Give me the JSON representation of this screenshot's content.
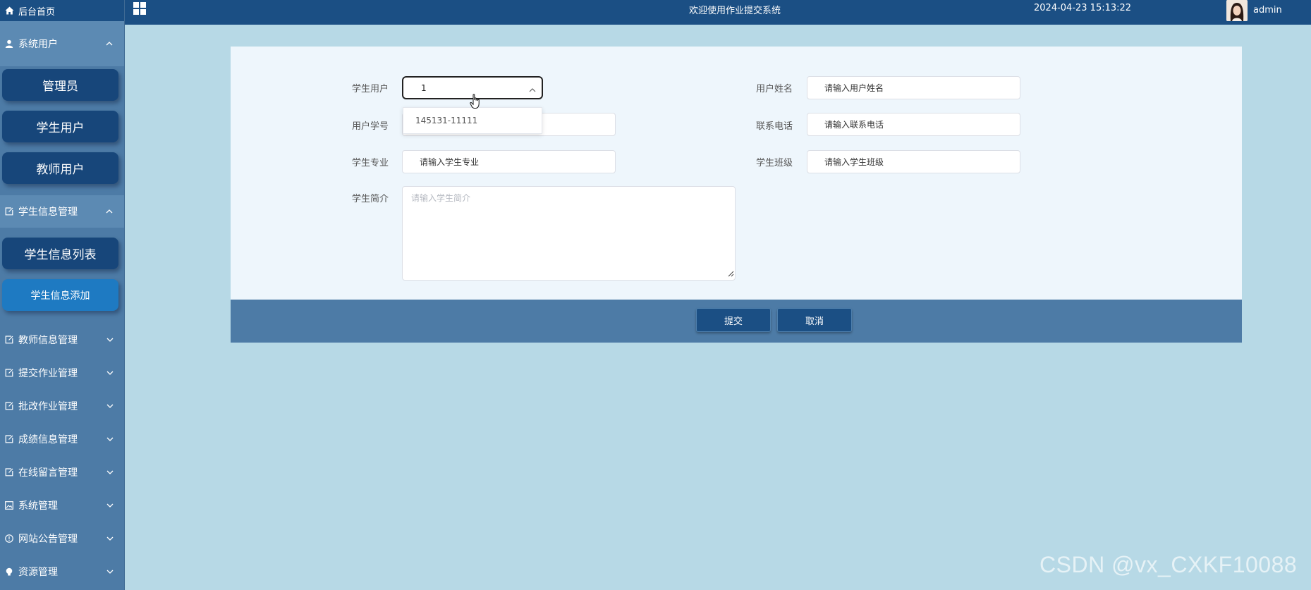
{
  "sidebar": {
    "home_label": "后台首页",
    "groups": [
      {
        "label": "系统用户",
        "icon": "user-icon",
        "open": true
      },
      {
        "label": "学生信息管理",
        "icon": "edit-icon",
        "open": true
      },
      {
        "label": "教师信息管理",
        "icon": "edit-icon"
      },
      {
        "label": "提交作业管理",
        "icon": "edit-icon"
      },
      {
        "label": "批改作业管理",
        "icon": "edit-icon"
      },
      {
        "label": "成绩信息管理",
        "icon": "edit-icon"
      },
      {
        "label": "在线留言管理",
        "icon": "edit-icon"
      },
      {
        "label": "系统管理",
        "icon": "picture-icon"
      },
      {
        "label": "网站公告管理",
        "icon": "info-icon"
      },
      {
        "label": "资源管理",
        "icon": "bulb-icon"
      }
    ],
    "system_user_items": [
      "管理员",
      "学生用户",
      "教师用户"
    ],
    "student_info_items": [
      "学生信息列表",
      "学生信息添加"
    ]
  },
  "topbar": {
    "title": "欢迎使用作业提交系统",
    "datetime": "2024-04-23 15:13:22",
    "username": "admin"
  },
  "form": {
    "student_user_label": "学生用户",
    "student_user_value": "1",
    "dropdown_option": "145131-11111",
    "user_name_label": "用户姓名",
    "user_name_placeholder": "请输入用户姓名",
    "student_no_label": "用户学号",
    "phone_label": "联系电话",
    "phone_placeholder": "请输入联系电话",
    "major_label": "学生专业",
    "major_placeholder": "请输入学生专业",
    "class_label": "学生班级",
    "class_placeholder": "请输入学生班级",
    "intro_label": "学生简介",
    "intro_placeholder": "请输入学生简介"
  },
  "actions": {
    "submit_label": "提交",
    "cancel_label": "取消"
  },
  "watermark": "CSDN @vx_CXKF10088",
  "colors": {
    "sidebar_bg": "#4d7ba6",
    "topbar_bg": "#1b4f84",
    "page_bg": "#b7d9e6",
    "active_item": "#1e7ac2"
  }
}
